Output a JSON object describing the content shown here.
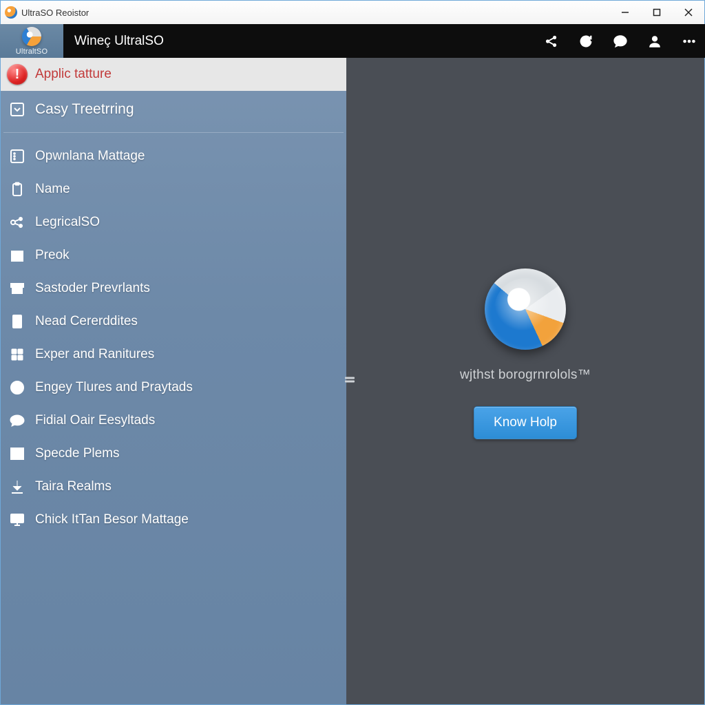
{
  "window": {
    "title": "UltraSO Reoistor"
  },
  "header": {
    "brand_label": "UltraltSO",
    "title": "Wineç UltralSO"
  },
  "sidebar": {
    "active": {
      "label": "Applic tatture"
    },
    "sub1": {
      "label": "Casy Treetrring"
    },
    "items": [
      {
        "label": "Opwnlana Mattage",
        "icon": "panel"
      },
      {
        "label": "Name",
        "icon": "clipboard"
      },
      {
        "label": "LegricalSO",
        "icon": "nodes"
      },
      {
        "label": "Preok",
        "icon": "stack"
      },
      {
        "label": "Sastoder Prevrlants",
        "icon": "archive"
      },
      {
        "label": "Nead Cererddites",
        "icon": "doc"
      },
      {
        "label": "Exper and Ranitures",
        "icon": "puzzle"
      },
      {
        "label": "Engey Tlures and Praytads",
        "icon": "clock"
      },
      {
        "label": "Fidial Oair Eesyltads",
        "icon": "chat"
      },
      {
        "label": "Specde Plems",
        "icon": "grid"
      },
      {
        "label": "Taira Realms",
        "icon": "download"
      },
      {
        "label": "Chick ItTan Besor Mattage",
        "icon": "monitor"
      }
    ]
  },
  "content": {
    "tagline": "wjthst borogrnrolols™",
    "help_button": "Know Holp"
  },
  "colors": {
    "accent_blue": "#2d8dd6",
    "sidebar_bg": "#6d89a8",
    "content_bg": "#4a4e55",
    "alert_red": "#c23a3a"
  }
}
